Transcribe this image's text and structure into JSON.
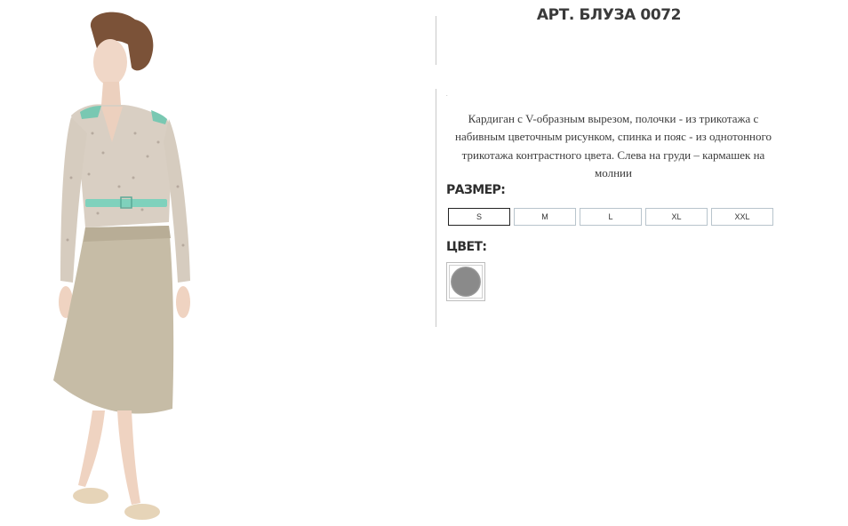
{
  "product": {
    "title": "АРТ. БЛУЗА 0072",
    "image_alt": "model-wearing-cardigan-and-skirt",
    "marker": ".",
    "description": "Кардиган с V-образным вырезом, полочки - из трикотажа с набивным цветочным рисунком, спинка и пояс - из однотонного трикотажа контрастного цвета. Слева на груди – кармашек на молнии"
  },
  "size": {
    "label": "РАЗМЕР:",
    "options": [
      "S",
      "M",
      "L",
      "XL",
      "XXL"
    ],
    "selected": "S"
  },
  "color": {
    "label": "ЦВЕТ:",
    "swatches": [
      {
        "name": "gray",
        "hex": "#8a8a8a",
        "selected": true
      }
    ]
  }
}
